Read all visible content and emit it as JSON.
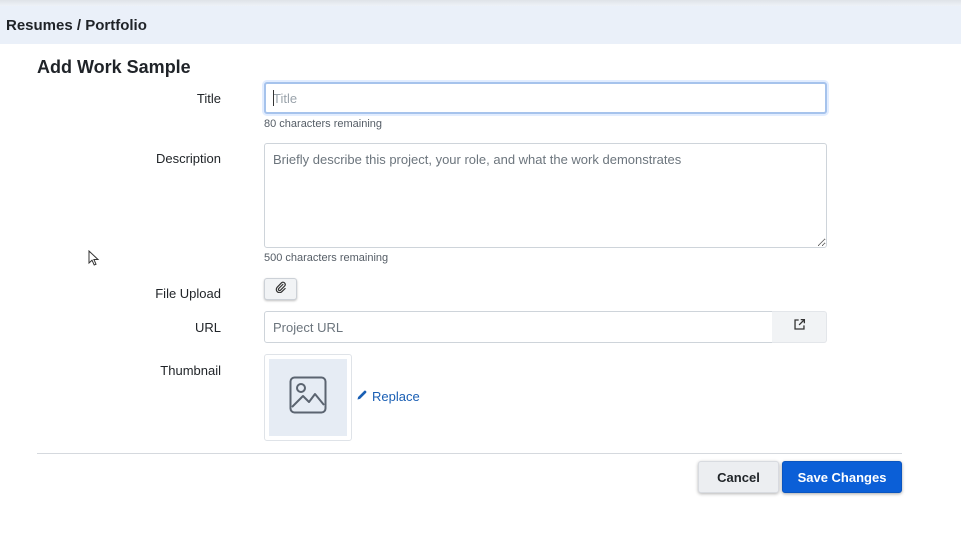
{
  "header": {
    "breadcrumb": "Resumes / Portfolio"
  },
  "form": {
    "title": "Add Work Sample",
    "fields": {
      "title": {
        "label": "Title",
        "value": "",
        "placeholder": "Title",
        "hint": "80 characters remaining"
      },
      "description": {
        "label": "Description",
        "value": "",
        "placeholder": "Briefly describe this project, your role, and what the work demonstrates",
        "hint": "500 characters remaining"
      },
      "file_upload": {
        "label": "File Upload",
        "icon": "paperclip-icon"
      },
      "url": {
        "label": "URL",
        "value": "",
        "placeholder": "Project URL",
        "icon": "external-link-icon"
      },
      "thumbnail": {
        "label": "Thumbnail",
        "placeholder_icon": "image-icon",
        "replace_label": "Replace",
        "replace_icon": "pencil-icon"
      }
    },
    "actions": {
      "cancel_label": "Cancel",
      "save_label": "Save Changes"
    }
  },
  "colors": {
    "primary": "#0b5fd7",
    "link": "#1a5fb4",
    "header_bg": "#eaf0f9",
    "focus_border": "#a6c3ec",
    "thumbnail_bg": "#e6ecf4"
  }
}
